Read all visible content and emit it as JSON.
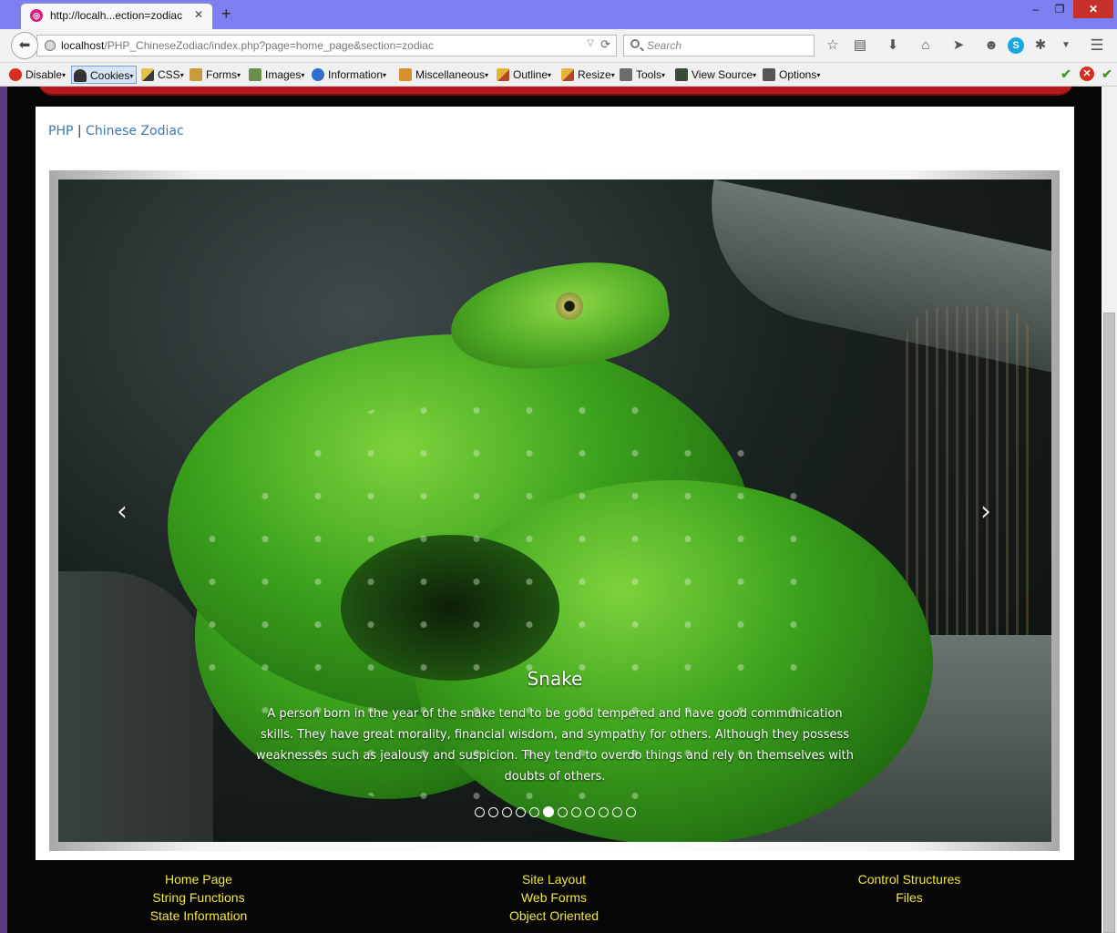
{
  "browser": {
    "tab_title": "http://localh...ection=zodiac",
    "tab_close": "✕",
    "new_tab": "+",
    "window_controls": {
      "minimize": "‒",
      "maximize": "❐",
      "close": "✕"
    },
    "url_host": "localhost",
    "url_path": "/PHP_ChineseZodiac/index.php?page=home_page&section=zodiac",
    "search_placeholder": "Search",
    "nav_icons": [
      "back-icon",
      "star-icon",
      "reading-list-icon",
      "download-icon",
      "home-icon",
      "send-icon",
      "chat-icon",
      "skype-icon",
      "bug-icon",
      "dropdown-icon",
      "menu-icon"
    ],
    "status_icons": [
      "ok-icon",
      "error-icon",
      "ok-icon"
    ]
  },
  "devbar": {
    "items": [
      {
        "label": "Disable",
        "icon": "disable-icon"
      },
      {
        "label": "Cookies",
        "icon": "cookies-icon"
      },
      {
        "label": "CSS",
        "icon": "css-icon"
      },
      {
        "label": "Forms",
        "icon": "forms-icon"
      },
      {
        "label": "Images",
        "icon": "images-icon"
      },
      {
        "label": "Information",
        "icon": "information-icon"
      },
      {
        "label": "Miscellaneous",
        "icon": "miscellaneous-icon"
      },
      {
        "label": "Outline",
        "icon": "outline-icon"
      },
      {
        "label": "Resize",
        "icon": "resize-icon"
      },
      {
        "label": "Tools",
        "icon": "tools-icon"
      },
      {
        "label": "View Source",
        "icon": "view-source-icon"
      },
      {
        "label": "Options",
        "icon": "options-icon"
      }
    ]
  },
  "page": {
    "breadcrumb": {
      "home": "PHP",
      "separator": "|",
      "current": "Chinese Zodiac"
    },
    "carousel": {
      "slide_title": "Snake",
      "slide_text": "A person born in the year of the snake tend to be good tempered and have good communication skills. They have great morality, financial wisdom, and sympathy for others. Although they possess weaknesses such as jealousy and suspicion. They tend to overdo things and rely on themselves with doubts of others.",
      "indicator_count": 12,
      "active_index": 5,
      "prev_icon": "chevron-left-icon",
      "next_icon": "chevron-right-icon"
    },
    "footer": {
      "col1": [
        "Home Page",
        "String Functions",
        "State Information"
      ],
      "col2": [
        "Site Layout",
        "Web Forms",
        "Object Oriented"
      ],
      "col3": [
        "Control Structures",
        "Files"
      ]
    }
  },
  "colors": {
    "titlebar": "#7d7ef0",
    "banner": "#b5191d",
    "link": "#3b78b5",
    "footer_link": "#f2e93b",
    "page_background": "#060606"
  }
}
